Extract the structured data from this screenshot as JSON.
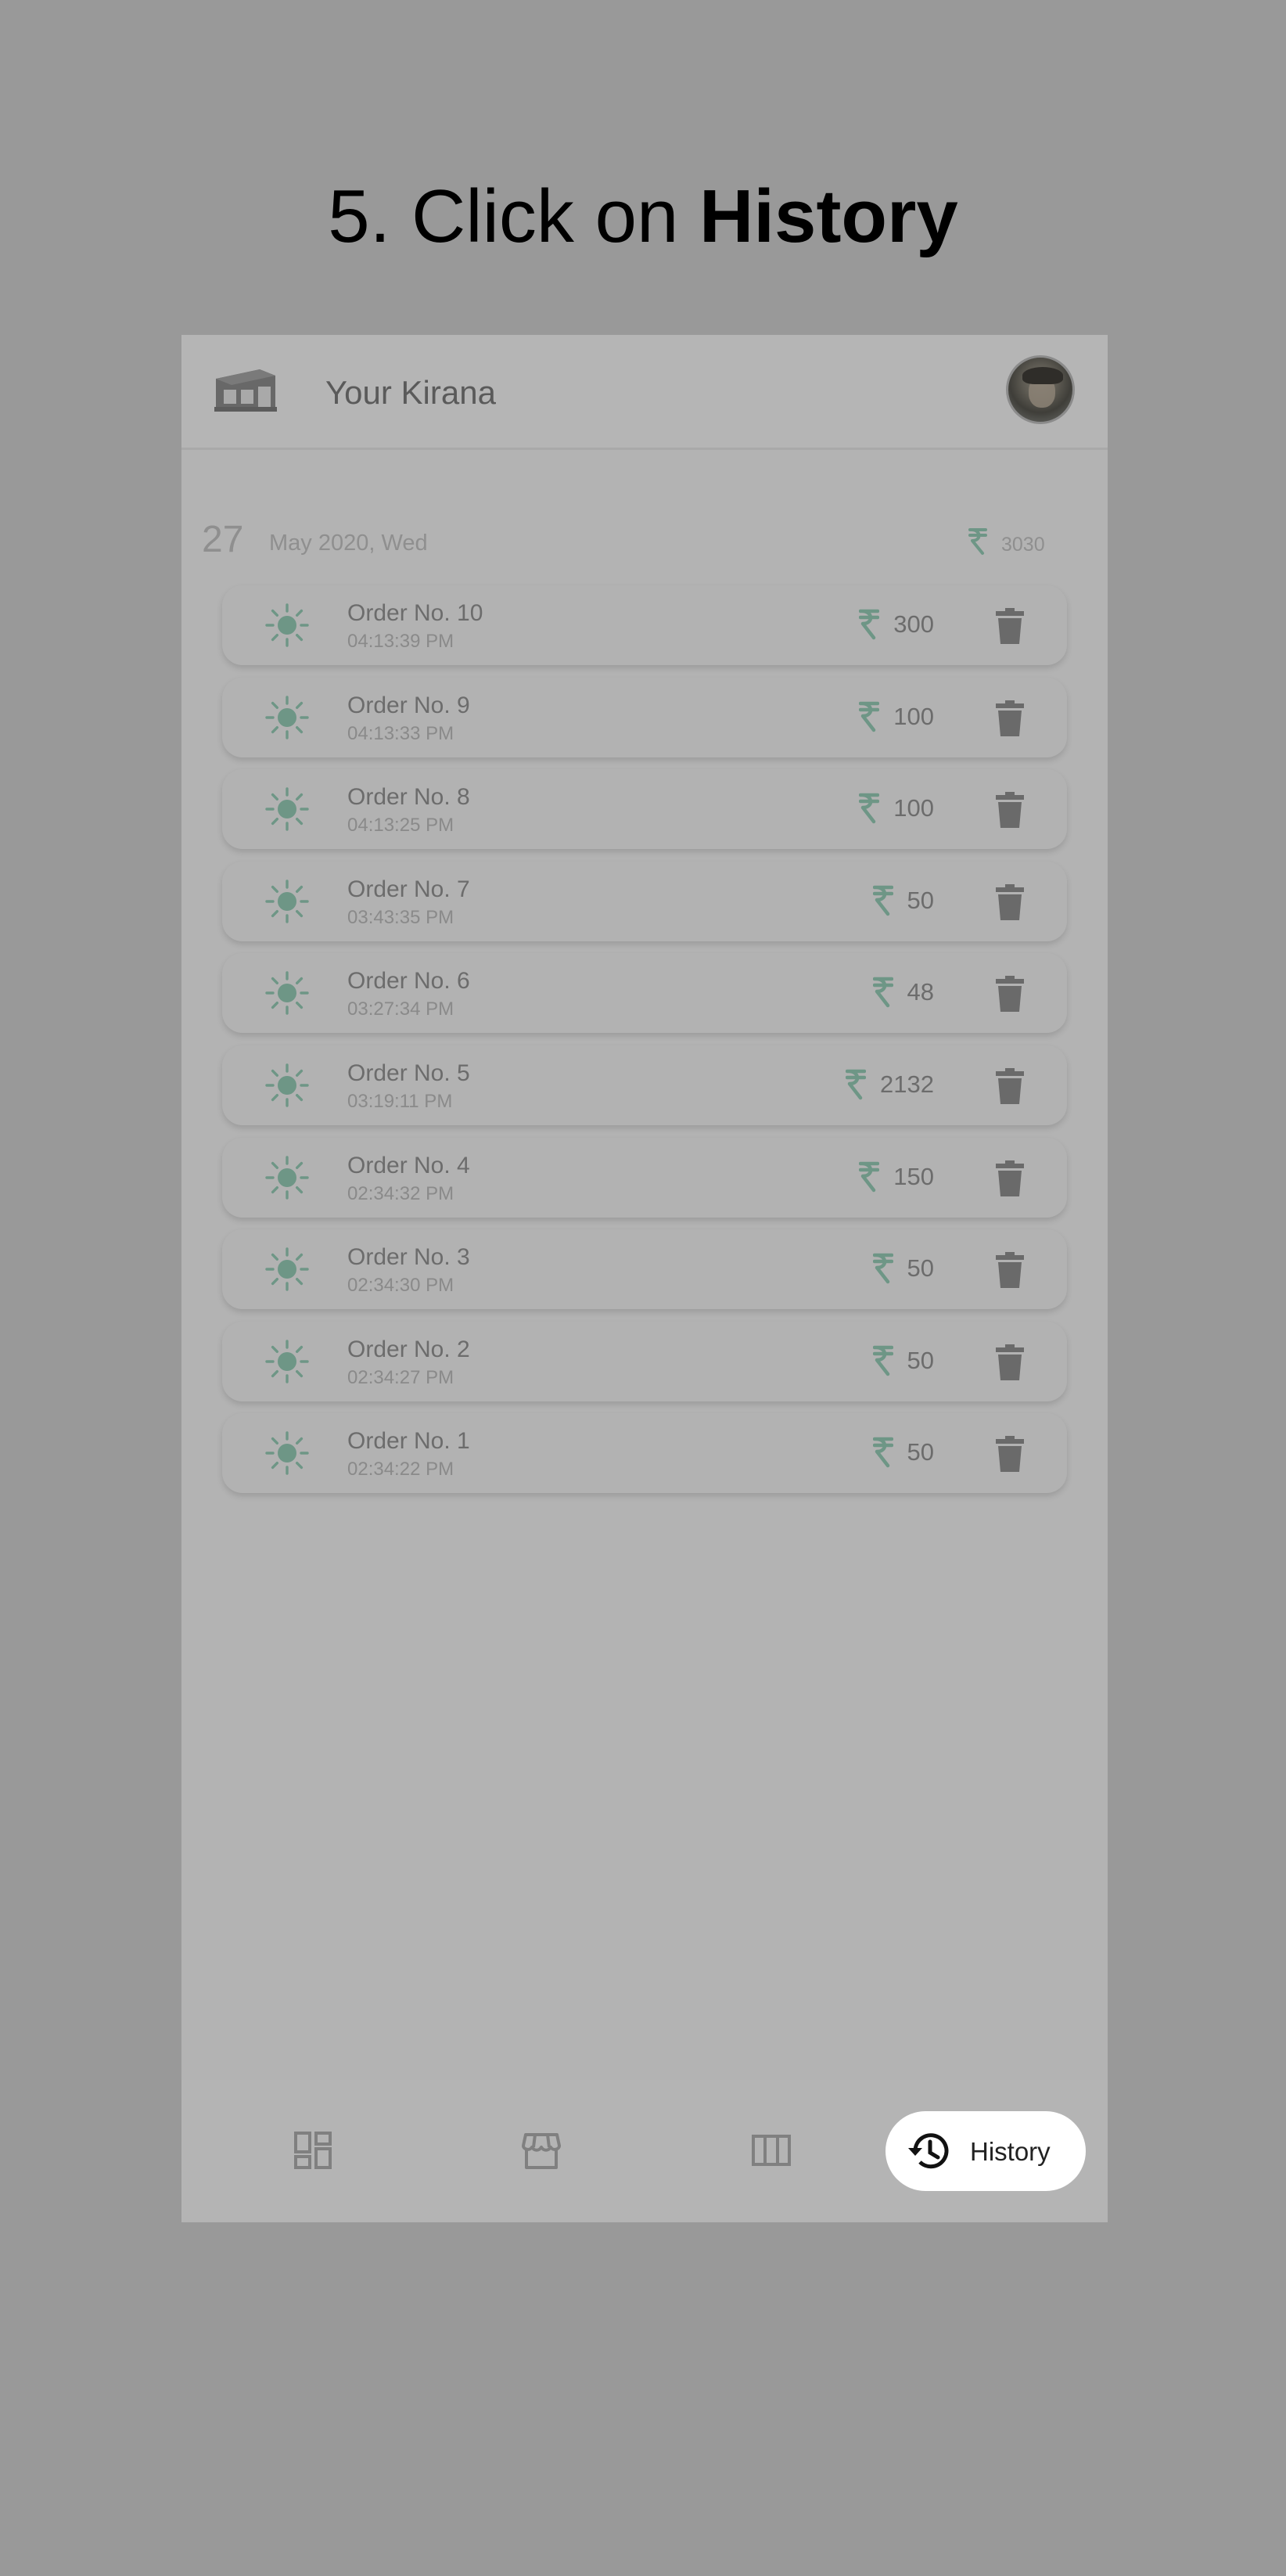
{
  "instruction": {
    "prefix": "5. Click on ",
    "emphasis": "History"
  },
  "app": {
    "title": "Your Kirana",
    "logo_icon": "store-icon",
    "avatar": "user-avatar"
  },
  "day_group": {
    "day": "27",
    "date_text": "May 2020, Wed",
    "total": "3030",
    "currency_icon": "rupee-icon"
  },
  "orders": [
    {
      "name": "Order No. 10",
      "time": "04:13:39 PM",
      "amount": "300"
    },
    {
      "name": "Order No. 9",
      "time": "04:13:33 PM",
      "amount": "100"
    },
    {
      "name": "Order No. 8",
      "time": "04:13:25 PM",
      "amount": "100"
    },
    {
      "name": "Order No. 7",
      "time": "03:43:35 PM",
      "amount": "50"
    },
    {
      "name": "Order No. 6",
      "time": "03:27:34 PM",
      "amount": "48"
    },
    {
      "name": "Order No. 5",
      "time": "03:19:11 PM",
      "amount": "2132"
    },
    {
      "name": "Order No. 4",
      "time": "02:34:32 PM",
      "amount": "150"
    },
    {
      "name": "Order No. 3",
      "time": "02:34:30 PM",
      "amount": "50"
    },
    {
      "name": "Order No. 2",
      "time": "02:34:27 PM",
      "amount": "50"
    },
    {
      "name": "Order No. 1",
      "time": "02:34:22 PM",
      "amount": "50"
    }
  ],
  "bottom_nav": {
    "items": [
      "dashboard-icon",
      "storefront-icon",
      "columns-icon",
      "history-icon"
    ],
    "active_label": "History"
  },
  "colors": {
    "overlay_background": "#999999",
    "app_surface": "#b3b3b3",
    "accent_sun": "#6e9686",
    "active_pill": "#ffffff"
  }
}
